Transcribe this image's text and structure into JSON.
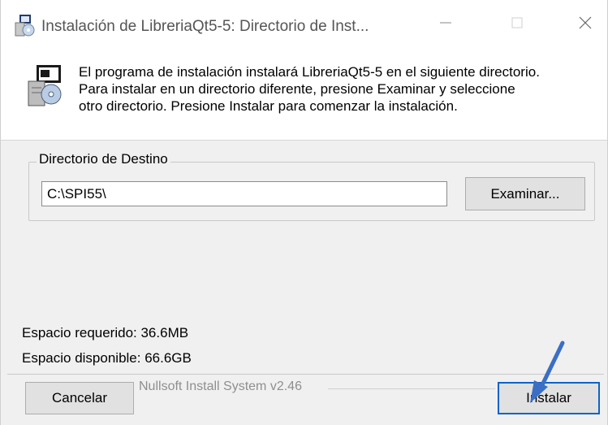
{
  "window": {
    "title": "Instalación de LibreriaQt5-5: Directorio de Inst...",
    "icon": "installer-icon",
    "controls": {
      "minimize": "—",
      "maximize": "☐",
      "close": "✕"
    }
  },
  "header": {
    "icon": "setup-package-icon",
    "description": "El programa de instalación instalará LibreriaQt5-5 en el siguiente directorio.\nPara instalar en un directorio diferente, presione Examinar y seleccione\notro directorio. Presione Instalar para comenzar la instalación."
  },
  "destination": {
    "group_label": "Directorio de Destino",
    "path_value": "C:\\SPI55\\",
    "browse_label": "Examinar..."
  },
  "space": {
    "required": "Espacio requerido: 36.6MB",
    "available": "Espacio disponible: 66.6GB"
  },
  "footer": {
    "cancel_label": "Cancelar",
    "brand": "Nullsoft Install System v2.46",
    "install_label": "Instalar"
  },
  "colors": {
    "accent": "#0a64c8",
    "annotation_arrow": "#3a6fc4",
    "window_bg": "#f0f0f0"
  },
  "annotation": {
    "icon": "pointer-arrow-icon"
  }
}
